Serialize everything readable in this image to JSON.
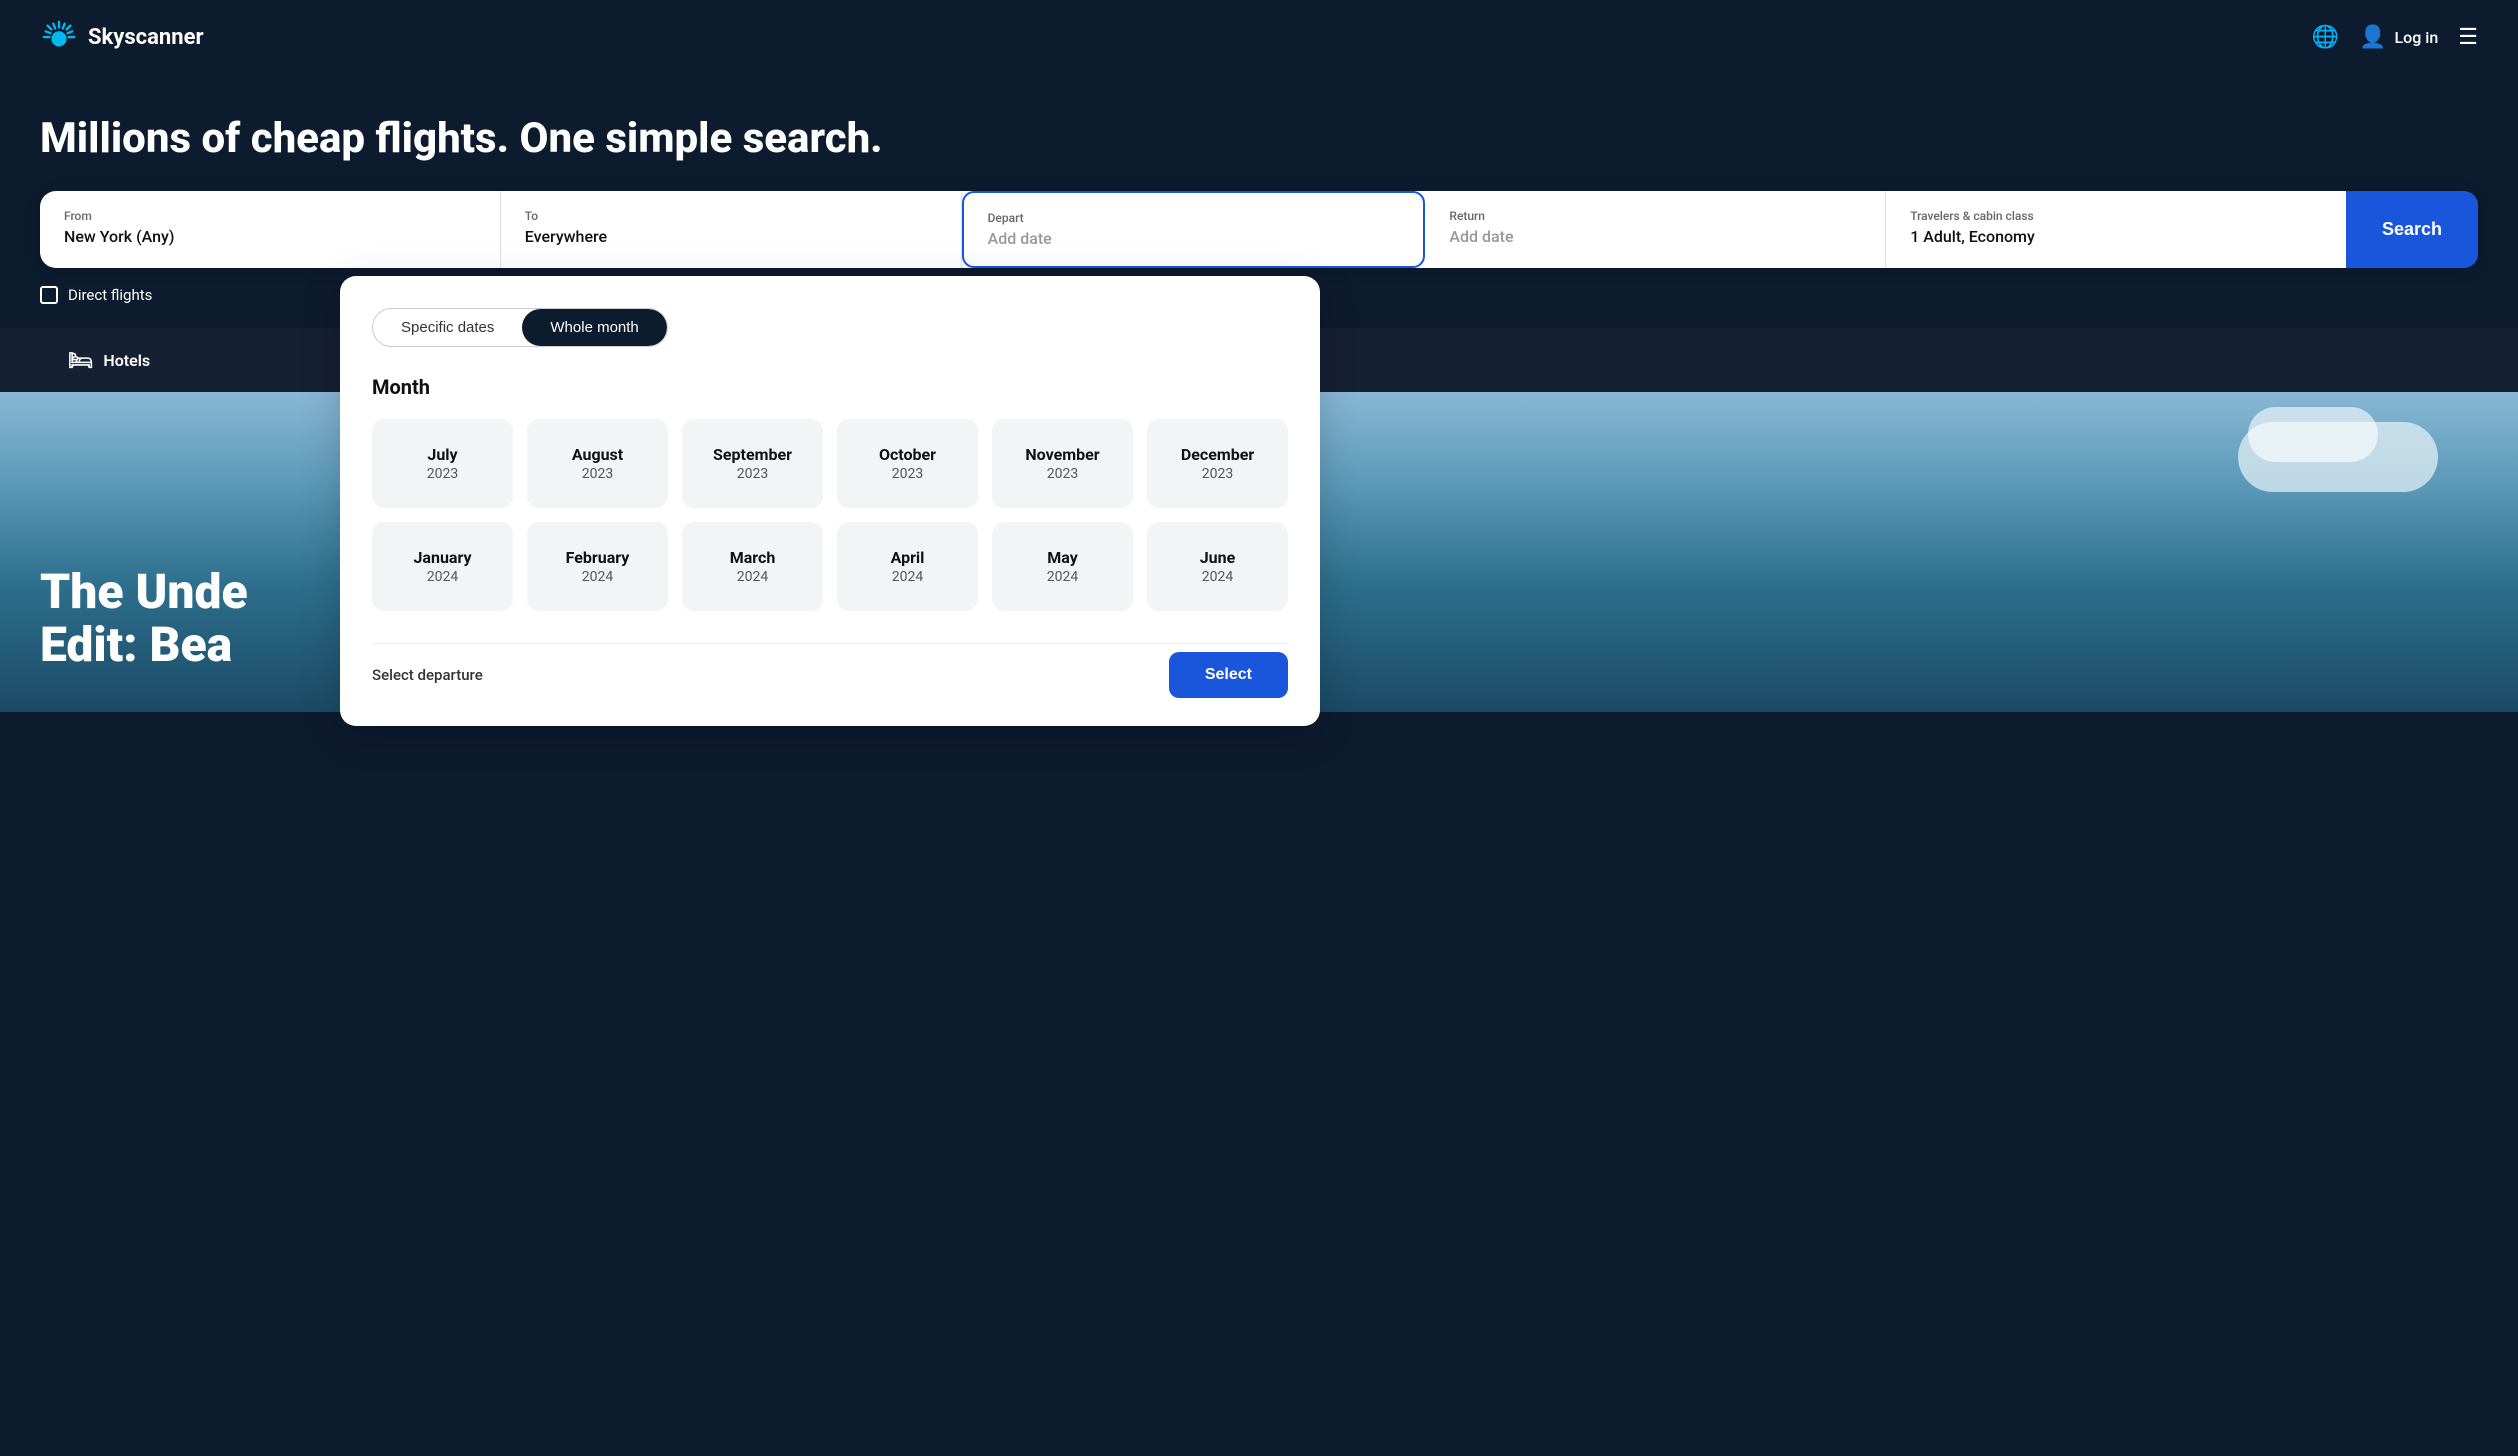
{
  "navbar": {
    "logo_text": "Skyscanner",
    "login_label": "Log in"
  },
  "hero": {
    "title": "Millions of cheap flights. One simple search."
  },
  "search_bar": {
    "from_label": "From",
    "from_value": "New York (Any)",
    "to_label": "To",
    "to_value": "Everywhere",
    "depart_label": "Depart",
    "depart_placeholder": "Add date",
    "return_label": "Return",
    "return_placeholder": "Add date",
    "travelers_label": "Travelers & cabin class",
    "travelers_value": "1 Adult, Economy",
    "search_btn": "Search"
  },
  "direct_flights": {
    "label": "Direct flights"
  },
  "tabs": [
    {
      "icon": "🛏",
      "label": "Hotels"
    }
  ],
  "hero_image": {
    "text_line1": "The Unde",
    "text_line2": "Edit: Bea"
  },
  "dropdown": {
    "toggle_specific": "Specific dates",
    "toggle_whole": "Whole month",
    "month_section_title": "Month",
    "months": [
      {
        "name": "July",
        "year": "2023"
      },
      {
        "name": "August",
        "year": "2023"
      },
      {
        "name": "September",
        "year": "2023"
      },
      {
        "name": "October",
        "year": "2023"
      },
      {
        "name": "November",
        "year": "2023"
      },
      {
        "name": "December",
        "year": "2023"
      },
      {
        "name": "January",
        "year": "2024"
      },
      {
        "name": "February",
        "year": "2024"
      },
      {
        "name": "March",
        "year": "2024"
      },
      {
        "name": "April",
        "year": "2024"
      },
      {
        "name": "May",
        "year": "2024"
      },
      {
        "name": "June",
        "year": "2024"
      }
    ],
    "footer_label": "Select departure",
    "select_btn": "Select"
  }
}
